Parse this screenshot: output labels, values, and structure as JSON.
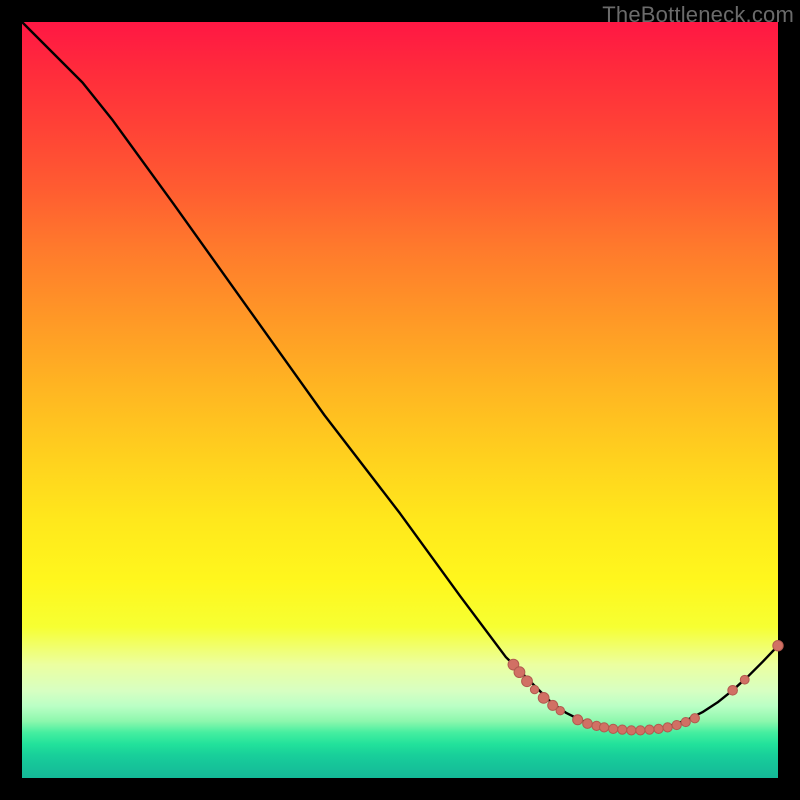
{
  "watermark": "TheBottleneck.com",
  "colors": {
    "curve_stroke": "#000000",
    "marker_fill": "#d17064",
    "marker_stroke": "#b25a4f",
    "background": "#000000"
  },
  "chart_data": {
    "type": "line",
    "title": "",
    "xlabel": "",
    "ylabel": "",
    "x_range": [
      0,
      100
    ],
    "y_range": [
      0,
      100
    ],
    "curve": [
      {
        "x": 0,
        "y": 100
      },
      {
        "x": 4,
        "y": 96
      },
      {
        "x": 8,
        "y": 92
      },
      {
        "x": 12,
        "y": 87
      },
      {
        "x": 20,
        "y": 76
      },
      {
        "x": 30,
        "y": 62
      },
      {
        "x": 40,
        "y": 48
      },
      {
        "x": 50,
        "y": 35
      },
      {
        "x": 58,
        "y": 24
      },
      {
        "x": 64,
        "y": 16
      },
      {
        "x": 66,
        "y": 14
      },
      {
        "x": 68,
        "y": 12
      },
      {
        "x": 70,
        "y": 10
      },
      {
        "x": 72,
        "y": 8.6
      },
      {
        "x": 74,
        "y": 7.6
      },
      {
        "x": 76,
        "y": 6.9
      },
      {
        "x": 78,
        "y": 6.5
      },
      {
        "x": 80,
        "y": 6.3
      },
      {
        "x": 82,
        "y": 6.3
      },
      {
        "x": 84,
        "y": 6.5
      },
      {
        "x": 86,
        "y": 7.0
      },
      {
        "x": 88,
        "y": 7.7
      },
      {
        "x": 90,
        "y": 8.7
      },
      {
        "x": 92,
        "y": 10.0
      },
      {
        "x": 94,
        "y": 11.6
      },
      {
        "x": 96,
        "y": 13.4
      },
      {
        "x": 98,
        "y": 15.4
      },
      {
        "x": 100,
        "y": 17.5
      }
    ],
    "markers": [
      {
        "x": 65.0,
        "y": 15.0,
        "r": 5.4
      },
      {
        "x": 65.8,
        "y": 14.0,
        "r": 5.4
      },
      {
        "x": 66.8,
        "y": 12.8,
        "r": 5.4
      },
      {
        "x": 67.8,
        "y": 11.7,
        "r": 4.2
      },
      {
        "x": 69.0,
        "y": 10.6,
        "r": 5.4
      },
      {
        "x": 70.2,
        "y": 9.6,
        "r": 5.0
      },
      {
        "x": 71.2,
        "y": 8.9,
        "r": 4.2
      },
      {
        "x": 73.5,
        "y": 7.7,
        "r": 5.0
      },
      {
        "x": 74.8,
        "y": 7.2,
        "r": 4.8
      },
      {
        "x": 76.0,
        "y": 6.9,
        "r": 4.6
      },
      {
        "x": 77.0,
        "y": 6.7,
        "r": 4.6
      },
      {
        "x": 78.2,
        "y": 6.5,
        "r": 4.6
      },
      {
        "x": 79.4,
        "y": 6.4,
        "r": 4.6
      },
      {
        "x": 80.6,
        "y": 6.3,
        "r": 4.6
      },
      {
        "x": 81.8,
        "y": 6.3,
        "r": 4.6
      },
      {
        "x": 83.0,
        "y": 6.4,
        "r": 4.6
      },
      {
        "x": 84.2,
        "y": 6.5,
        "r": 4.6
      },
      {
        "x": 85.4,
        "y": 6.7,
        "r": 4.6
      },
      {
        "x": 86.6,
        "y": 7.0,
        "r": 4.6
      },
      {
        "x": 87.8,
        "y": 7.4,
        "r": 4.6
      },
      {
        "x": 89.0,
        "y": 7.9,
        "r": 4.6
      },
      {
        "x": 94.0,
        "y": 11.6,
        "r": 4.8
      },
      {
        "x": 95.6,
        "y": 13.0,
        "r": 4.4
      },
      {
        "x": 100.0,
        "y": 17.5,
        "r": 5.2
      }
    ]
  }
}
